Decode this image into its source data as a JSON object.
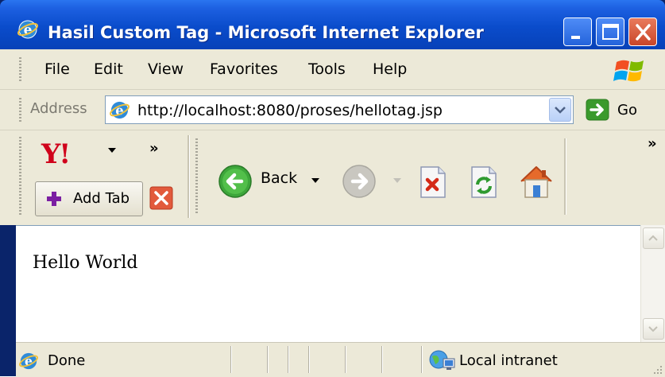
{
  "window": {
    "title": "Hasil Custom Tag - Microsoft Internet Explorer",
    "controls": [
      "minimize",
      "maximize",
      "close"
    ]
  },
  "menu": {
    "items": [
      "File",
      "Edit",
      "View",
      "Favorites",
      "Tools",
      "Help"
    ]
  },
  "address_bar": {
    "label": "Address",
    "url": "http://localhost:8080/proses/hellotag.jsp",
    "go_label": "Go"
  },
  "yahoo_toolbar": {
    "logo": "Y!",
    "add_tab_label": "Add Tab",
    "overflow": "»"
  },
  "nav_toolbar": {
    "back_label": "Back",
    "overflow": "»",
    "buttons": [
      "back",
      "forward",
      "stop",
      "refresh",
      "home"
    ]
  },
  "page": {
    "content_text": "Hello World"
  },
  "status_bar": {
    "status_text": "Done",
    "zone_text": "Local intranet"
  },
  "colors": {
    "title_bar": "#0a4ccb",
    "chrome": "#ece9d8",
    "address_border": "#7f9db9"
  }
}
